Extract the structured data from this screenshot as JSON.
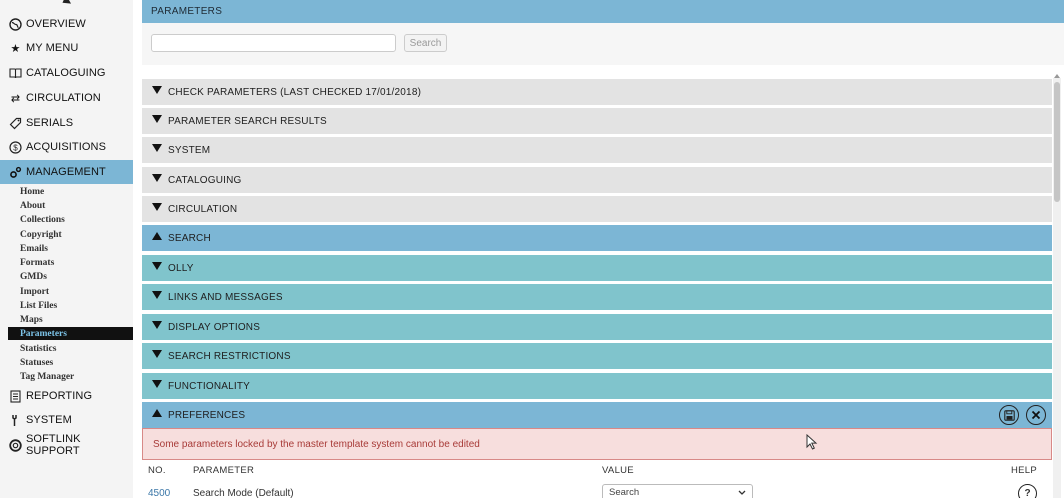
{
  "sidebar": {
    "items": [
      {
        "label": "OVERVIEW",
        "icon": "globe-icon"
      },
      {
        "label": "MY MENU",
        "icon": "star-icon"
      },
      {
        "label": "CATALOGUING",
        "icon": "book-icon"
      },
      {
        "label": "CIRCULATION",
        "icon": "exchange-arrows-icon"
      },
      {
        "label": "SERIALS",
        "icon": "tag-icon"
      },
      {
        "label": "ACQUISITIONS",
        "icon": "dollar-circle-icon"
      },
      {
        "label": "MANAGEMENT",
        "icon": "gears-icon",
        "active": true
      },
      {
        "label": "REPORTING",
        "icon": "document-icon"
      },
      {
        "label": "SYSTEM",
        "icon": "wrench-icon"
      },
      {
        "label": "SOFTLINK SUPPORT",
        "icon": "lifebuoy-icon"
      }
    ],
    "management_subitems": [
      "Home",
      "About",
      "Collections",
      "Copyright",
      "Emails",
      "Formats",
      "GMDs",
      "Import",
      "List Files",
      "Maps",
      "Parameters",
      "Statistics",
      "Statuses",
      "Tag Manager"
    ],
    "selected_subitem": "Parameters"
  },
  "header": {
    "title": "PARAMETERS"
  },
  "search": {
    "placeholder": "",
    "value": "",
    "button_label": "Search"
  },
  "sections": [
    {
      "label": "CHECK PARAMETERS (LAST CHECKED 17/01/2018)",
      "state": "collapsed"
    },
    {
      "label": "PARAMETER SEARCH RESULTS",
      "state": "collapsed"
    },
    {
      "label": "SYSTEM",
      "state": "collapsed"
    },
    {
      "label": "CATALOGUING",
      "state": "collapsed"
    },
    {
      "label": "CIRCULATION",
      "state": "collapsed"
    },
    {
      "label": "SEARCH",
      "state": "expanded"
    },
    {
      "label": "OLLY",
      "state": "collapsed"
    },
    {
      "label": "LINKS AND MESSAGES",
      "state": "collapsed"
    },
    {
      "label": "DISPLAY OPTIONS",
      "state": "collapsed"
    },
    {
      "label": "SEARCH RESTRICTIONS",
      "state": "collapsed"
    },
    {
      "label": "FUNCTIONALITY",
      "state": "collapsed"
    },
    {
      "label": "PREFERENCES",
      "state": "expanded"
    }
  ],
  "notice": "Some parameters locked by the master template system cannot be edited",
  "table": {
    "columns": [
      "NO.",
      "PARAMETER",
      "VALUE",
      "HELP"
    ],
    "rows": [
      {
        "no": "4500",
        "parameter": "Search Mode (Default)",
        "value": "Search"
      }
    ]
  },
  "colors": {
    "accent_blue": "#7cb6d5",
    "teal": "#80c4cc",
    "section_gray": "#e3e3e3",
    "notice_bg": "#f7dedd",
    "notice_text": "#a83b38",
    "link_blue": "#3b77a8"
  }
}
